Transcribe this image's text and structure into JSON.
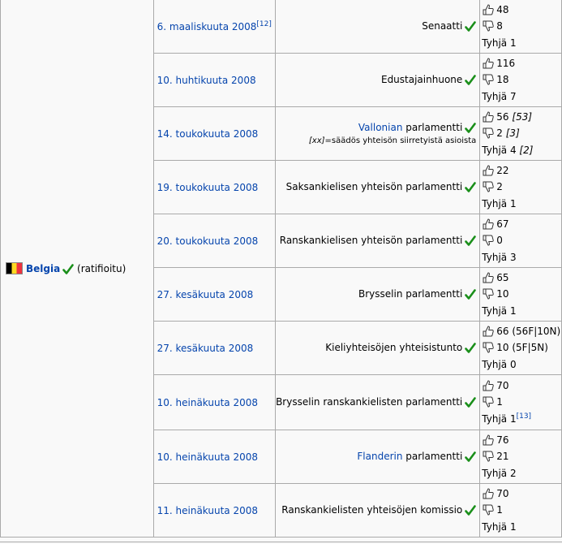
{
  "country": {
    "name": "Belgia",
    "status": "(ratifioitu)",
    "flag_colors": [
      "#000000",
      "#fdda24",
      "#ef3340"
    ]
  },
  "colors": {
    "link": "#0645ad",
    "check": "#1a8f1a",
    "border": "#aaaaaa",
    "background": "#f9f9f9"
  },
  "rows": [
    {
      "date": "6. maaliskuuta 2008",
      "date_sup": "[12]",
      "body_link": "",
      "body_text": "Senaatti",
      "note_code": "",
      "note_text": "",
      "yes": "48",
      "yes_note": "",
      "no": "8",
      "no_note": "",
      "abstain": "Tyhjä 1",
      "abstain_note": "",
      "abstain_sup": ""
    },
    {
      "date": "10. huhtikuuta 2008",
      "date_sup": "",
      "body_link": "",
      "body_text": "Edustajainhuone",
      "note_code": "",
      "note_text": "",
      "yes": "116",
      "yes_note": "",
      "no": "18",
      "no_note": "",
      "abstain": "Tyhjä 7",
      "abstain_note": "",
      "abstain_sup": ""
    },
    {
      "date": "14. toukokuuta 2008",
      "date_sup": "",
      "body_link": "Vallonian",
      "body_text": " parlamentti",
      "note_code": "[xx]",
      "note_text": "=säädös yhteisön siirretyistä asioista",
      "yes": "56",
      "yes_note": "[53]",
      "no": "2",
      "no_note": "[3]",
      "abstain": "Tyhjä 4",
      "abstain_note": "[2]",
      "abstain_sup": ""
    },
    {
      "date": "19. toukokuuta 2008",
      "date_sup": "",
      "body_link": "",
      "body_text": "Saksankielisen yhteisön parlamentti",
      "note_code": "",
      "note_text": "",
      "yes": "22",
      "yes_note": "",
      "no": "2",
      "no_note": "",
      "abstain": "Tyhjä 1",
      "abstain_note": "",
      "abstain_sup": ""
    },
    {
      "date": "20. toukokuuta 2008",
      "date_sup": "",
      "body_link": "",
      "body_text": "Ranskankielisen yhteisön parlamentti",
      "note_code": "",
      "note_text": "",
      "yes": "67",
      "yes_note": "",
      "no": "0",
      "no_note": "",
      "abstain": "Tyhjä 3",
      "abstain_note": "",
      "abstain_sup": ""
    },
    {
      "date": "27. kesäkuuta 2008",
      "date_sup": "",
      "body_link": "",
      "body_text": "Brysselin parlamentti",
      "note_code": "",
      "note_text": "",
      "yes": "65",
      "yes_note": "",
      "no": "10",
      "no_note": "",
      "abstain": "Tyhjä 1",
      "abstain_note": "",
      "abstain_sup": ""
    },
    {
      "date": "27. kesäkuuta 2008",
      "date_sup": "",
      "body_link": "",
      "body_text": "Kieliyhteisöjen yhteisistunto",
      "note_code": "",
      "note_text": "",
      "yes": "66 (56F|10N)",
      "yes_note": "",
      "no": "10 (5F|5N)",
      "no_note": "",
      "abstain": "Tyhjä 0",
      "abstain_note": "",
      "abstain_sup": ""
    },
    {
      "date": "10. heinäkuuta 2008",
      "date_sup": "",
      "body_link": "",
      "body_text": "Brysselin ranskankielisten parlamentti",
      "note_code": "",
      "note_text": "",
      "yes": "70",
      "yes_note": "",
      "no": "1",
      "no_note": "",
      "abstain": "Tyhjä 1",
      "abstain_note": "",
      "abstain_sup": "[13]"
    },
    {
      "date": "10. heinäkuuta 2008",
      "date_sup": "",
      "body_link": "Flanderin",
      "body_text": " parlamentti",
      "note_code": "",
      "note_text": "",
      "yes": "76",
      "yes_note": "",
      "no": "21",
      "no_note": "",
      "abstain": "Tyhjä 2",
      "abstain_note": "",
      "abstain_sup": ""
    },
    {
      "date": "11. heinäkuuta 2008",
      "date_sup": "",
      "body_link": "",
      "body_text": "Ranskankielisten yhteisöjen komissio",
      "note_code": "",
      "note_text": "",
      "yes": "70",
      "yes_note": "",
      "no": "1",
      "no_note": "",
      "abstain": "Tyhjä 1",
      "abstain_note": "",
      "abstain_sup": ""
    }
  ]
}
